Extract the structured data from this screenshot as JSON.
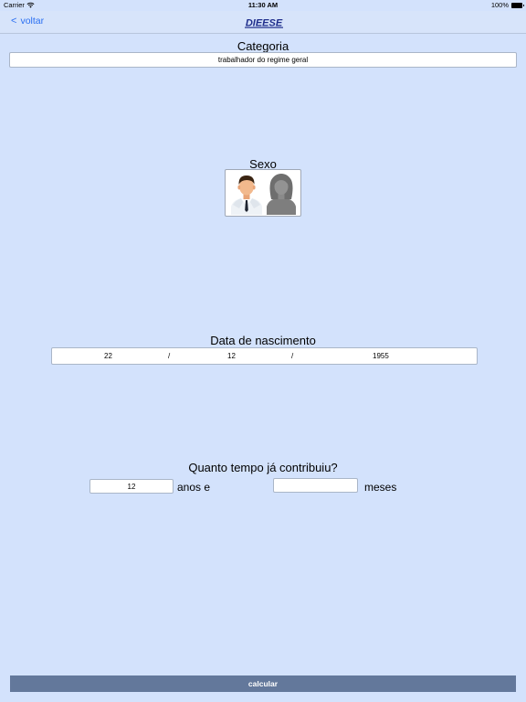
{
  "status_bar": {
    "carrier": "Carrier",
    "time": "11:30 AM",
    "battery": "100%"
  },
  "nav": {
    "back_label": "voltar",
    "back_chevron": "<",
    "logo_text": "DIEESE"
  },
  "categoria": {
    "label": "Categoria",
    "value": "trabalhador do regime geral"
  },
  "sexo": {
    "label": "Sexo",
    "options": [
      "male-avatar-icon",
      "female-avatar-icon"
    ],
    "selected": "male"
  },
  "nascimento": {
    "label": "Data de nascimento",
    "day": "22",
    "month": "12",
    "year": "1955",
    "separator": "/"
  },
  "contribuicao": {
    "label": "Quanto tempo já contribuiu?",
    "anos_value": "12",
    "anos_label": "anos e",
    "meses_value": "",
    "meses_label": "meses"
  },
  "calcular": {
    "label": "calcular"
  },
  "colors": {
    "background": "#d3e2fc",
    "accent": "#2a6ff2",
    "button": "#63789b",
    "logo": "#1f2e8c"
  }
}
